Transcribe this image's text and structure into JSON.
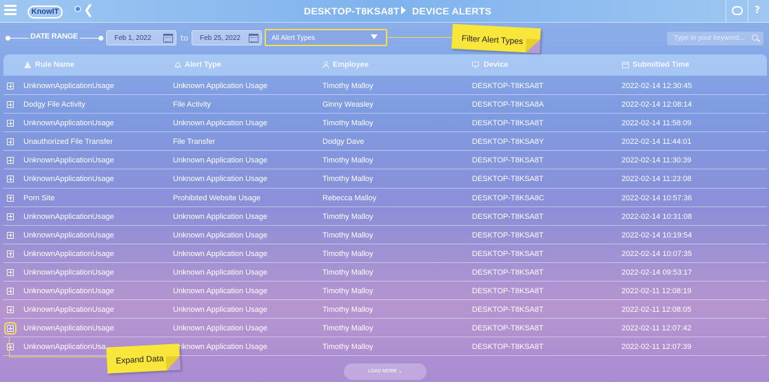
{
  "header": {
    "logo_text": "KnowIT",
    "device": "DESKTOP-T8KSA8T",
    "page": "DEVICE ALERTS",
    "help": "?"
  },
  "filters": {
    "date_range_label": "DATE RANGE",
    "from_date": "Feb 1, 2022",
    "to_label": "to",
    "to_date": "Feb 25, 2022",
    "alert_type": "All Alert Types",
    "search_placeholder": "Type in your keyword..."
  },
  "annotations": {
    "filter_note": "Filter Alert Types",
    "expand_note": "Expand Data"
  },
  "table": {
    "columns": [
      "Rule Name",
      "Alert Type",
      "Employee",
      "Device",
      "Submitted Time"
    ],
    "rows": [
      [
        "UnknownApplicationUsage",
        "Unknown Application Usage",
        "Timothy Malloy",
        "DESKTOP-T8KSA8T",
        "2022-02-14 12:30:45"
      ],
      [
        "Dodgy File Activity",
        "File Activity",
        "Ginny Weasley",
        "DESKTOP-T8KSA8A",
        "2022-02-14 12:08:14"
      ],
      [
        "UnknownApplicationUsage",
        "Unknown Application Usage",
        "Timothy Malloy",
        "DESKTOP-T8KSA8T",
        "2022-02-14 11:58:09"
      ],
      [
        "Unauthorized File Transfer",
        "File Transfer",
        "Dodgy Dave",
        "DESKTOP-T8KSA8Y",
        "2022-02-14 11:44:01"
      ],
      [
        "UnknownApplicationUsage",
        "Unknown Application Usage",
        "Timothy Malloy",
        "DESKTOP-T8KSA8T",
        "2022-02-14 11:30:39"
      ],
      [
        "UnknownApplicationUsage",
        "Unknown Application Usage",
        "Timothy Malloy",
        "DESKTOP-T8KSA8T",
        "2022-02-14 11:23:08"
      ],
      [
        "Porn Site",
        "Prohibited Website Usage",
        "Rebecca Malloy",
        "DESKTOP-T8KSA8C",
        "2022-02-14 10:57:36"
      ],
      [
        "UnknownApplicationUsage",
        "Unknown Application Usage",
        "Timothy Malloy",
        "DESKTOP-T8KSA8T",
        "2022-02-14 10:31:08"
      ],
      [
        "UnknownApplicationUsage",
        "Unknown Application Usage",
        "Timothy Malloy",
        "DESKTOP-T8KSA8T",
        "2022-02-14 10:19:54"
      ],
      [
        "UnknownApplicationUsage",
        "Unknown Application Usage",
        "Timothy Malloy",
        "DESKTOP-T8KSA8T",
        "2022-02-14 10:07:35"
      ],
      [
        "UnknownApplicationUsage",
        "Unknown Application Usage",
        "Timothy Malloy",
        "DESKTOP-T8KSA8T",
        "2022-02-14 09:53:17"
      ],
      [
        "UnknownApplicationUsage",
        "Unknown Application Usage",
        "Timothy Malloy",
        "DESKTOP-T8KSA8T",
        "2022-02-11 12:08:19"
      ],
      [
        "UnknownApplicationUsage",
        "Unknown Application Usage",
        "Timothy Malloy",
        "DESKTOP-T8KSA8T",
        "2022-02-11 12:08:05"
      ],
      [
        "UnknownApplicationUsage",
        "Unknown Application Usage",
        "Timothy Malloy",
        "DESKTOP-T8KSA8T",
        "2022-02-11 12:07:42"
      ],
      [
        "UnknownApplicationUsa",
        "Unknown Application Usage",
        "Timothy Malloy",
        "DESKTOP-T8KSA8T",
        "2022-02-11 12:07:39"
      ]
    ]
  },
  "load_more": "LOAD MORE ⌄",
  "colors": {
    "highlight": "#f2df55",
    "sticky": "#f8e63a"
  }
}
